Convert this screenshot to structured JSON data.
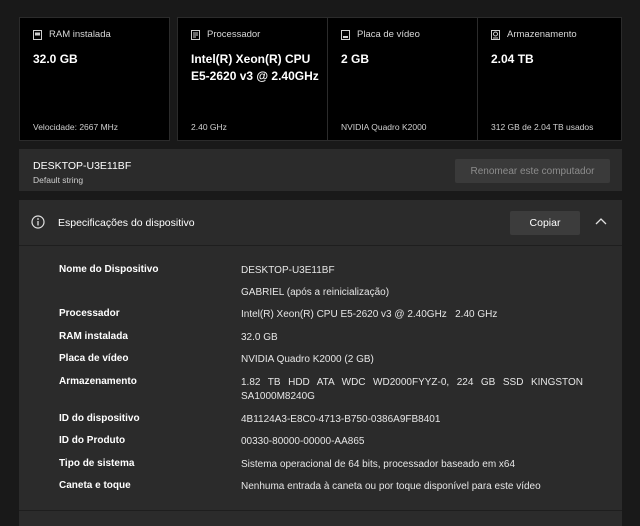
{
  "cards": [
    {
      "title": "RAM instalada",
      "icon": "ram-icon",
      "value": "32.0 GB",
      "detail": "Velocidade: 2667 MHz"
    },
    {
      "title": "Processador",
      "icon": "processor-icon",
      "value": "Intel(R) Xeon(R) CPU E5-2620 v3 @ 2.40GHz",
      "detail": "2.40 GHz"
    },
    {
      "title": "Placa de vídeo",
      "icon": "gpu-icon",
      "value": "2 GB",
      "detail": "NVIDIA Quadro K2000"
    },
    {
      "title": "Armazenamento",
      "icon": "storage-icon",
      "value": "2.04 TB",
      "detail": "312 GB de 2.04 TB usados"
    }
  ],
  "computer": {
    "name": "DESKTOP-U3E11BF",
    "subtitle": "Default string",
    "rename_label": "Renomear este computador"
  },
  "specs": {
    "title": "Especificações do dispositivo",
    "copy_label": "Copiar",
    "rows": [
      {
        "label": "Nome do Dispositivo",
        "value": "DESKTOP-U3E11BF"
      },
      {
        "label": "",
        "value": "GABRIEL (após a reinicialização)"
      },
      {
        "label": "Processador",
        "value": "Intel(R) Xeon(R) CPU E5-2620 v3 @ 2.40GHz   2.40 GHz"
      },
      {
        "label": "RAM instalada",
        "value": "32.0 GB"
      },
      {
        "label": "Placa de vídeo",
        "value": "NVIDIA Quadro K2000 (2 GB)"
      },
      {
        "label": "Armazenamento",
        "value": "1.82 TB HDD ATA WDC WD2000FYYZ-0, 224 GB SSD KINGSTON SA1000M8240G"
      },
      {
        "label": "ID do dispositivo",
        "value": "4B1124A3-E8C0-4713-B750-0386A9FB8401"
      },
      {
        "label": "ID do Produto",
        "value": "00330-80000-00000-AA865"
      },
      {
        "label": "Tipo de sistema",
        "value": "Sistema operacional de 64 bits, processador baseado em x64"
      },
      {
        "label": "Caneta e toque",
        "value": "Nenhuma entrada à caneta ou por toque disponível para este vídeo"
      }
    ]
  }
}
